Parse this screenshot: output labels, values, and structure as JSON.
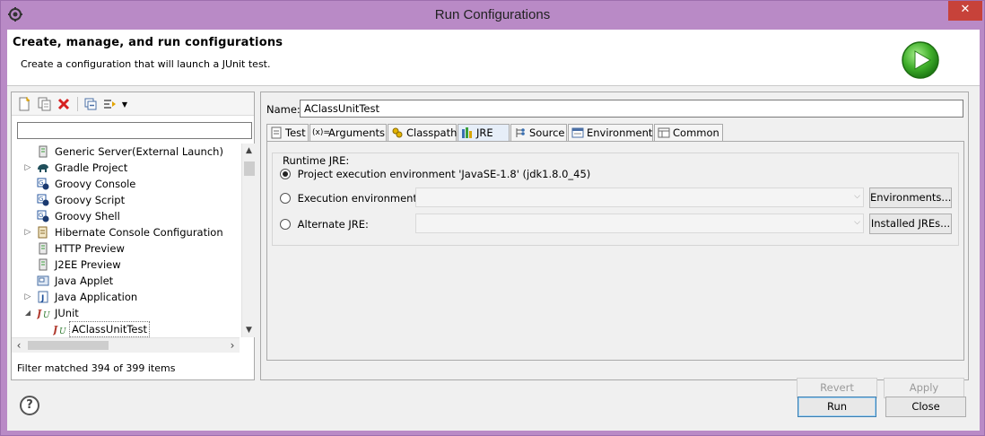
{
  "window": {
    "title": "Run Configurations",
    "close_glyph": "✕"
  },
  "header": {
    "title": "Create, manage, and run configurations",
    "subtitle": "Create a configuration that will launch a JUnit test."
  },
  "left": {
    "filter_placeholder": "",
    "tree": [
      {
        "label": "Generic Server(External Launch)",
        "icon": "server-icon",
        "twisty": ""
      },
      {
        "label": "Gradle Project",
        "icon": "gradle-elephant-icon",
        "twisty": "▷"
      },
      {
        "label": "Groovy Console",
        "icon": "groovy-console-icon",
        "twisty": ""
      },
      {
        "label": "Groovy Script",
        "icon": "groovy-script-icon",
        "twisty": ""
      },
      {
        "label": "Groovy Shell",
        "icon": "groovy-shell-icon",
        "twisty": ""
      },
      {
        "label": "Hibernate Console Configuration",
        "icon": "hibernate-icon",
        "twisty": "▷"
      },
      {
        "label": "HTTP Preview",
        "icon": "http-preview-icon",
        "twisty": ""
      },
      {
        "label": "J2EE Preview",
        "icon": "j2ee-preview-icon",
        "twisty": ""
      },
      {
        "label": "Java Applet",
        "icon": "java-applet-icon",
        "twisty": ""
      },
      {
        "label": "Java Application",
        "icon": "java-application-icon",
        "twisty": "▷"
      },
      {
        "label": "JUnit",
        "icon": "junit-icon",
        "twisty": "◢"
      },
      {
        "label": "AClassUnitTest",
        "icon": "junit-test-icon",
        "twisty": "",
        "selected": true
      }
    ],
    "filter_status": "Filter matched 394 of 399 items"
  },
  "right": {
    "name_label": "Name:",
    "name_value": "AClassUnitTest",
    "tabs": [
      {
        "label": "Test",
        "icon": "test-tab-icon"
      },
      {
        "label": "Arguments",
        "icon": "arguments-icon"
      },
      {
        "label": "Classpath",
        "icon": "classpath-icon"
      },
      {
        "label": "JRE",
        "icon": "jre-icon",
        "active": true
      },
      {
        "label": "Source",
        "icon": "source-icon"
      },
      {
        "label": "Environment",
        "icon": "environment-icon"
      },
      {
        "label": "Common",
        "icon": "common-icon"
      }
    ],
    "group_title": "Runtime JRE:",
    "radio_project": "Project execution environment 'JavaSE-1.8' (jdk1.8.0_45)",
    "radio_execution": "Execution environment:",
    "radio_alternate": "Alternate JRE:",
    "environments_button": "Environments...",
    "installed_jres_button": "Installed JREs...",
    "revert_button": "Revert",
    "apply_button": "Apply"
  },
  "footer": {
    "help_glyph": "?",
    "run_button": "Run",
    "close_button": "Close"
  }
}
